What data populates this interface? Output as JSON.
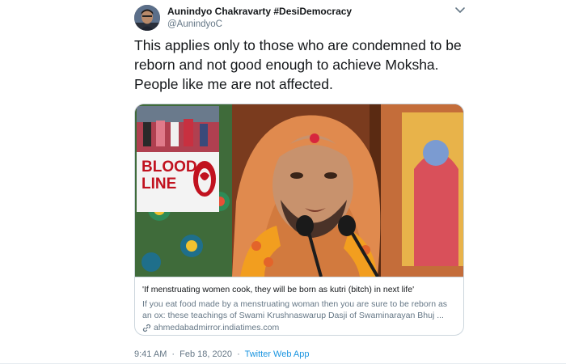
{
  "author": {
    "display_name": "Aunindyo Chakravarty #DesiDemocracy",
    "handle": "@AunindyoC"
  },
  "tweet": {
    "lines": [
      "This applies only to those who are condemned to be",
      "reborn and not good enough to achieve Moksha.",
      "People like me are not affected."
    ]
  },
  "card": {
    "image_logo_text": [
      "BLOOD",
      "LINE"
    ],
    "title": "'If menstruating women cook, they will be born as kutri (bitch) in next life'",
    "description_lines": [
      "If you eat food made by a menstruating woman then you are sure to be reborn as",
      "an ox: these teachings of Swami Krushnaswarup Dasji of Swaminarayan Bhuj ..."
    ],
    "domain": "ahmedabadmirror.indiatimes.com"
  },
  "meta": {
    "time": "9:41 AM",
    "separator": "·",
    "date": "Feb 18, 2020",
    "app": "Twitter Web App"
  },
  "icons": {
    "caret": "chevron-down-icon",
    "link": "link-icon"
  },
  "colors": {
    "text_primary": "#14171a",
    "text_secondary": "#657786",
    "link_blue": "#1b95e0",
    "border": "#ccd6dd",
    "robe_saffron": "#e08a4e",
    "tilak_red": "#d7263d"
  }
}
